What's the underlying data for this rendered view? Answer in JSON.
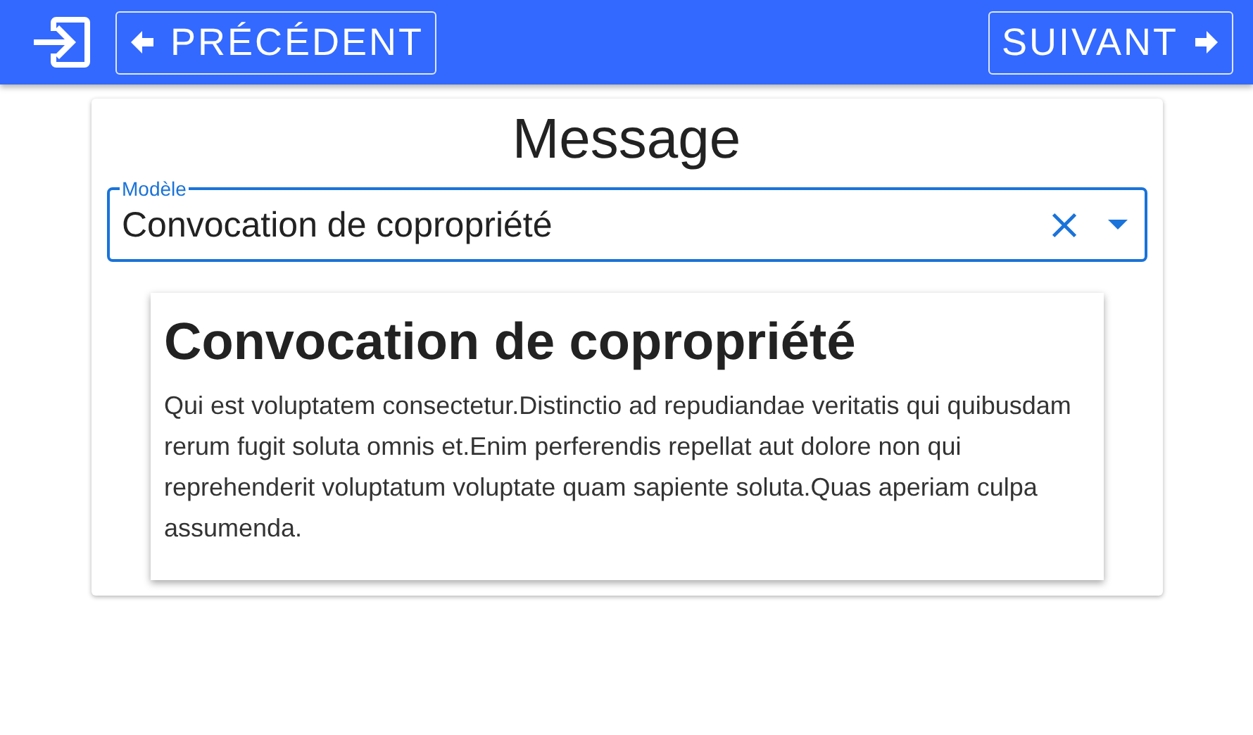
{
  "toolbar": {
    "prev_button": "PRÉCÉDENT",
    "next_button": "SUIVANT"
  },
  "card": {
    "title": "Message",
    "template_field": {
      "label": "Modèle",
      "value": "Convocation de copropriété"
    },
    "preview": {
      "heading": "Convocation de copropriété",
      "body": "Qui est voluptatem consectetur.Distinctio ad repudiandae veritatis qui quibusdam rerum fugit soluta omnis et.Enim perferendis repellat aut dolore non qui reprehenderit voluptatum voluptate quam sapiente soluta.Quas aperiam culpa assumenda."
    }
  }
}
